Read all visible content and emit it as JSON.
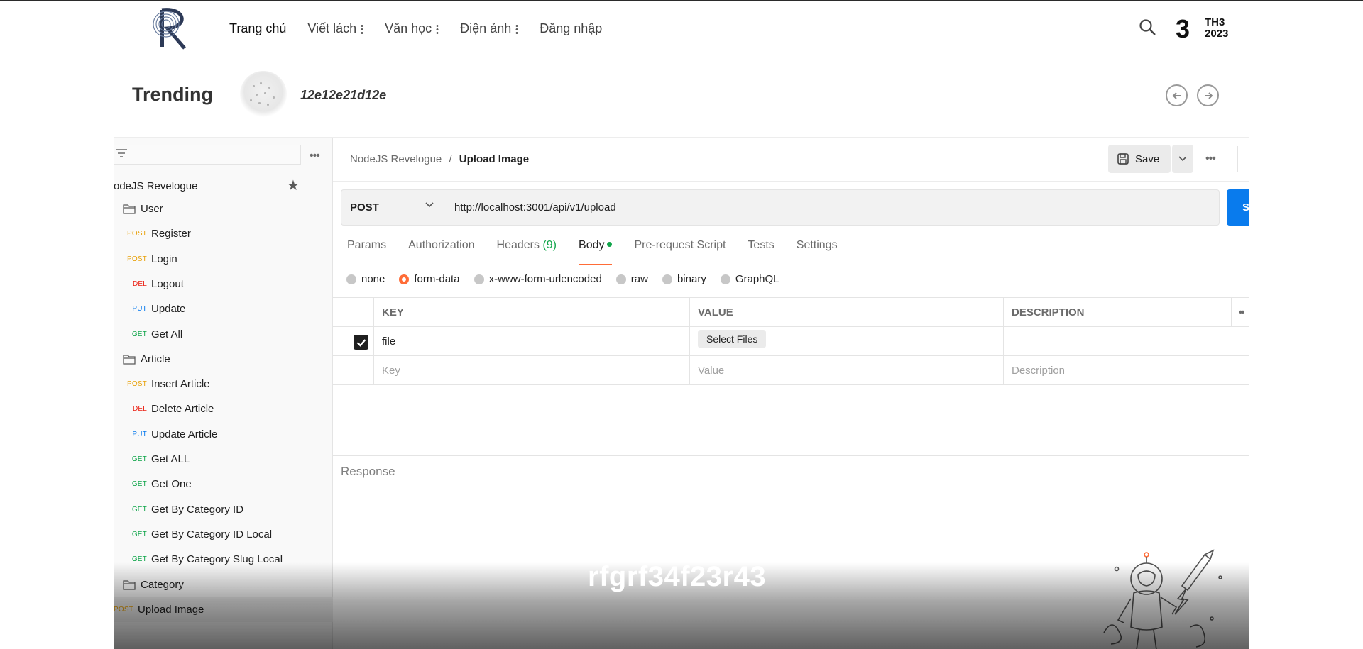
{
  "nav": {
    "items": [
      {
        "label": "Trang chủ"
      },
      {
        "label": "Viết lách"
      },
      {
        "label": "Văn học"
      },
      {
        "label": "Điện ảnh"
      },
      {
        "label": "Đăng nhập"
      }
    ],
    "date_day": "3",
    "date_month": "TH3",
    "date_year": "2023"
  },
  "trending": {
    "title": "Trending",
    "item_title": "12e12e21d12e"
  },
  "postman": {
    "sidebar": {
      "collection": "odeJS Revelogue",
      "tree": [
        {
          "type": "folder",
          "label": "User"
        },
        {
          "type": "request",
          "method": "POST",
          "label": "Register"
        },
        {
          "type": "request",
          "method": "POST",
          "label": "Login"
        },
        {
          "type": "request",
          "method": "DEL",
          "label": "Logout"
        },
        {
          "type": "request",
          "method": "PUT",
          "label": "Update"
        },
        {
          "type": "request",
          "method": "GET",
          "label": "Get All"
        },
        {
          "type": "folder",
          "label": "Article"
        },
        {
          "type": "request",
          "method": "POST",
          "label": "Insert Article"
        },
        {
          "type": "request",
          "method": "DEL",
          "label": "Delete Article"
        },
        {
          "type": "request",
          "method": "PUT",
          "label": "Update Article"
        },
        {
          "type": "request",
          "method": "GET",
          "label": "Get ALL"
        },
        {
          "type": "request",
          "method": "GET",
          "label": "Get One"
        },
        {
          "type": "request",
          "method": "GET",
          "label": "Get By Category ID"
        },
        {
          "type": "request",
          "method": "GET",
          "label": "Get By Category ID Local"
        },
        {
          "type": "request",
          "method": "GET",
          "label": "Get By Category Slug Local"
        },
        {
          "type": "folder",
          "label": "Category"
        },
        {
          "type": "request",
          "method": "POST",
          "label": "Upload Image",
          "selected": true
        }
      ]
    },
    "breadcrumb": {
      "parent": "NodeJS Revelogue",
      "separator": "/",
      "current": "Upload Image"
    },
    "save_label": "Save",
    "request": {
      "method": "POST",
      "url": "http://localhost:3001/api/v1/upload",
      "send_label": "S"
    },
    "tabs": [
      {
        "label": "Params"
      },
      {
        "label": "Authorization"
      },
      {
        "label": "Headers",
        "count": "(9)"
      },
      {
        "label": "Body",
        "active": true
      },
      {
        "label": "Pre-request Script"
      },
      {
        "label": "Tests"
      },
      {
        "label": "Settings"
      }
    ],
    "body_types": [
      {
        "label": "none"
      },
      {
        "label": "form-data",
        "selected": true
      },
      {
        "label": "x-www-form-urlencoded"
      },
      {
        "label": "raw"
      },
      {
        "label": "binary"
      },
      {
        "label": "GraphQL"
      }
    ],
    "table": {
      "headers": {
        "key": "KEY",
        "value": "VALUE",
        "description": "DESCRIPTION"
      },
      "row": {
        "key": "file",
        "value_button": "Select Files",
        "checked": true
      },
      "placeholders": {
        "key": "Key",
        "value": "Value",
        "description": "Description"
      }
    },
    "response_title": "Response"
  },
  "overlay_title": "rfgrf34f23r43",
  "colors": {
    "accent": "#ff6c37",
    "send": "#097bed",
    "post": "#e8a20c",
    "get": "#10a54a",
    "put": "#097bed",
    "del": "#eb2013"
  }
}
